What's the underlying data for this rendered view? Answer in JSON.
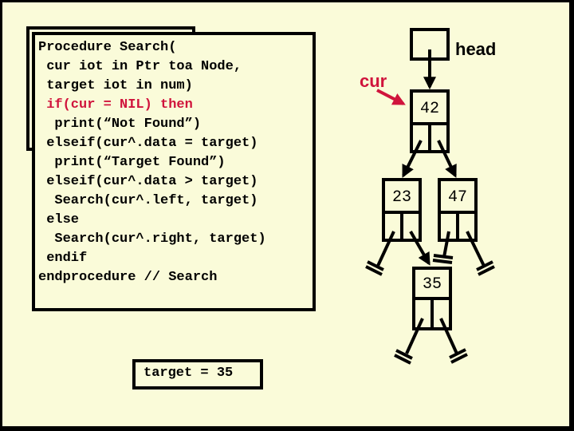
{
  "code": {
    "lines": [
      {
        "text": "Procedure Search(",
        "highlight": false
      },
      {
        "text": " cur iot in Ptr toa Node,",
        "highlight": false
      },
      {
        "text": " target iot in num)",
        "highlight": false
      },
      {
        "text": " if(cur = NIL) then",
        "highlight": true
      },
      {
        "text": "  print(“Not Found”)",
        "highlight": false
      },
      {
        "text": " elseif(cur^.data = target)",
        "highlight": false
      },
      {
        "text": "  print(“Target Found”)",
        "highlight": false
      },
      {
        "text": " elseif(cur^.data > target)",
        "highlight": false
      },
      {
        "text": "  Search(cur^.left, target)",
        "highlight": false
      },
      {
        "text": " else",
        "highlight": false
      },
      {
        "text": "  Search(cur^.right, target)",
        "highlight": false
      },
      {
        "text": " endif",
        "highlight": false
      },
      {
        "text": "endprocedure // Search",
        "highlight": false
      }
    ],
    "highlight_color": "#d0143c"
  },
  "target_box": {
    "text": "target = 35"
  },
  "tree": {
    "head_label": "head",
    "cur_label": "cur",
    "cur_color": "#d0143c",
    "nodes": [
      {
        "id": "n42",
        "value": "42"
      },
      {
        "id": "n23",
        "value": "23"
      },
      {
        "id": "n47",
        "value": "47"
      },
      {
        "id": "n35",
        "value": "35"
      }
    ],
    "edges": [
      {
        "from": "head",
        "to": "n42"
      },
      {
        "from": "n42",
        "to": "n23",
        "side": "left"
      },
      {
        "from": "n42",
        "to": "n47",
        "side": "right"
      },
      {
        "from": "n23",
        "to": "n35",
        "side": "right"
      }
    ],
    "nil_pointers": [
      {
        "node": "n23",
        "side": "left"
      },
      {
        "node": "n47",
        "side": "left"
      },
      {
        "node": "n47",
        "side": "right"
      },
      {
        "node": "n35",
        "side": "left"
      },
      {
        "node": "n35",
        "side": "right"
      }
    ],
    "cur_points_to": "n42"
  },
  "colors": {
    "background": "#fafbd9",
    "ink": "#000000"
  }
}
